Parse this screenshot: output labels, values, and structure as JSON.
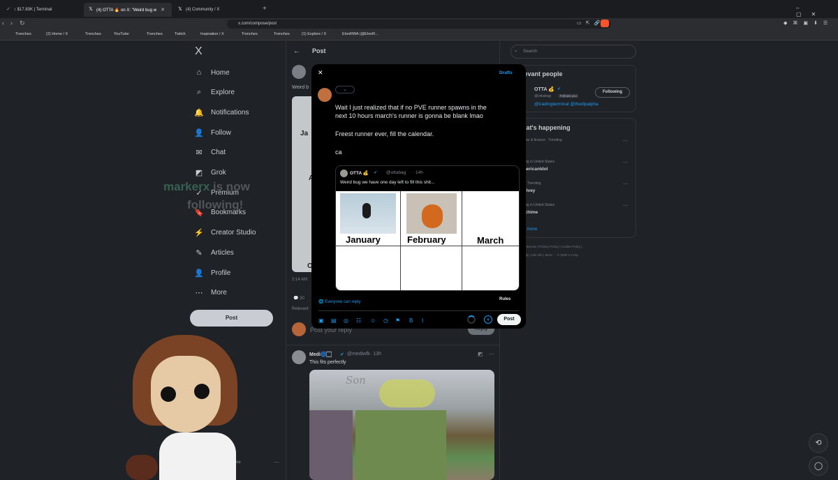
{
  "browser": {
    "tabs": [
      {
        "label": "↕ $17.83K | Terminal",
        "active": false
      },
      {
        "label": "(4) OTTA 🔥 on X: \"Weird bug w",
        "active": true
      },
      {
        "label": "(4)    Community / X",
        "active": false
      }
    ],
    "new_tab": "+",
    "url": "x.com/compose/post",
    "bookmarks": [
      "Trenches",
      "(2) Home / X",
      "Trenches",
      "YouTube",
      "Trenches",
      "Twitch",
      "Inspiration / X",
      "Trenches",
      "Trenches",
      "(1) Explore / X",
      "ElonRWA (@ElonR..."
    ]
  },
  "sidebar": {
    "logo": "X",
    "items": [
      {
        "label": "Home",
        "icon": "home-icon",
        "glyph": "⌂"
      },
      {
        "label": "Explore",
        "icon": "search-icon",
        "glyph": "⌕"
      },
      {
        "label": "Notifications",
        "icon": "bell-icon",
        "glyph": "🔔"
      },
      {
        "label": "Follow",
        "icon": "person-add-icon",
        "glyph": "👤"
      },
      {
        "label": "Chat",
        "icon": "chat-icon",
        "glyph": "✉"
      },
      {
        "label": "Grok",
        "icon": "grok-icon",
        "glyph": "◩"
      },
      {
        "label": "Premium",
        "icon": "premium-icon",
        "glyph": "✓"
      },
      {
        "label": "Bookmarks",
        "icon": "bookmark-icon",
        "glyph": "🔖"
      },
      {
        "label": "Creator Studio",
        "icon": "creator-icon",
        "glyph": "⚡"
      },
      {
        "label": "Articles",
        "icon": "articles-icon",
        "glyph": "✎"
      },
      {
        "label": "Profile",
        "icon": "profile-icon",
        "glyph": "👤"
      },
      {
        "label": "More",
        "icon": "more-icon",
        "glyph": "⋯"
      }
    ],
    "post_button": "Post",
    "account_handle": "ttthename"
  },
  "overlay": {
    "line1a": "markerx",
    "line1b": "is now",
    "line2": "following!"
  },
  "center": {
    "header_title": "Post",
    "back": "←",
    "partial_text_1": "Weird b",
    "grid_letters": [
      "Ja",
      "A",
      "O"
    ],
    "time": "2:14 AM",
    "reply_count": "30",
    "relevant": "Relevant",
    "reply_placeholder": "Post your reply",
    "reply_button": "Reply",
    "reply_post": {
      "name": "Medi🌀🏻",
      "handle": "@mediwfk",
      "time": "13h",
      "text": "This fits perfectly",
      "image_caption": "Son"
    }
  },
  "right": {
    "search_placeholder": "Search",
    "relevant_title": "levant people",
    "person_name": "OTTA 💰",
    "person_handle": "@ottabag",
    "follows_you": "Follows you",
    "following_btn": "Following",
    "person_bio": "@tradingterminal @thedipalpha",
    "happening_title": "hat's happening",
    "trends": [
      {
        "context": "ness & finance · Trending",
        "topic": "L"
      },
      {
        "context": "ding in United States",
        "topic": "mericanIdol"
      },
      {
        "context": "s · Trending",
        "topic": "n Ivey"
      },
      {
        "context": "ding in United States",
        "topic": "ychime"
      }
    ],
    "show_more": "w more",
    "footer_1": "s of Service  |  Privacy Policy  |  Cookie Policy  |",
    "footer_2": "sibility  |  Ads info  |  More ···  © 2026 X Corp."
  },
  "modal": {
    "close": "✕",
    "drafts": "Drafts",
    "audience": "⌄",
    "text_line1": "Wait I just realized that if no PVE runner spawns in the",
    "text_line2": "next 10 hours march's runner is gonna be blank lmao",
    "text_line3": "Freest runner ever, fill the calendar.",
    "text_line4": "ca",
    "quote": {
      "name": "OTTA 💰",
      "handle": "@ottabag",
      "time": "14h",
      "text": "Weird bug we have one day left to fill this shit...",
      "months": [
        "January",
        "February",
        "March"
      ]
    },
    "everyone_reply": "Everyone can reply",
    "rules": "Rules",
    "post_btn": "Post"
  },
  "colors": {
    "accent": "#1d9bf0",
    "bg": "#1f2227",
    "modal_bg": "#000000"
  }
}
